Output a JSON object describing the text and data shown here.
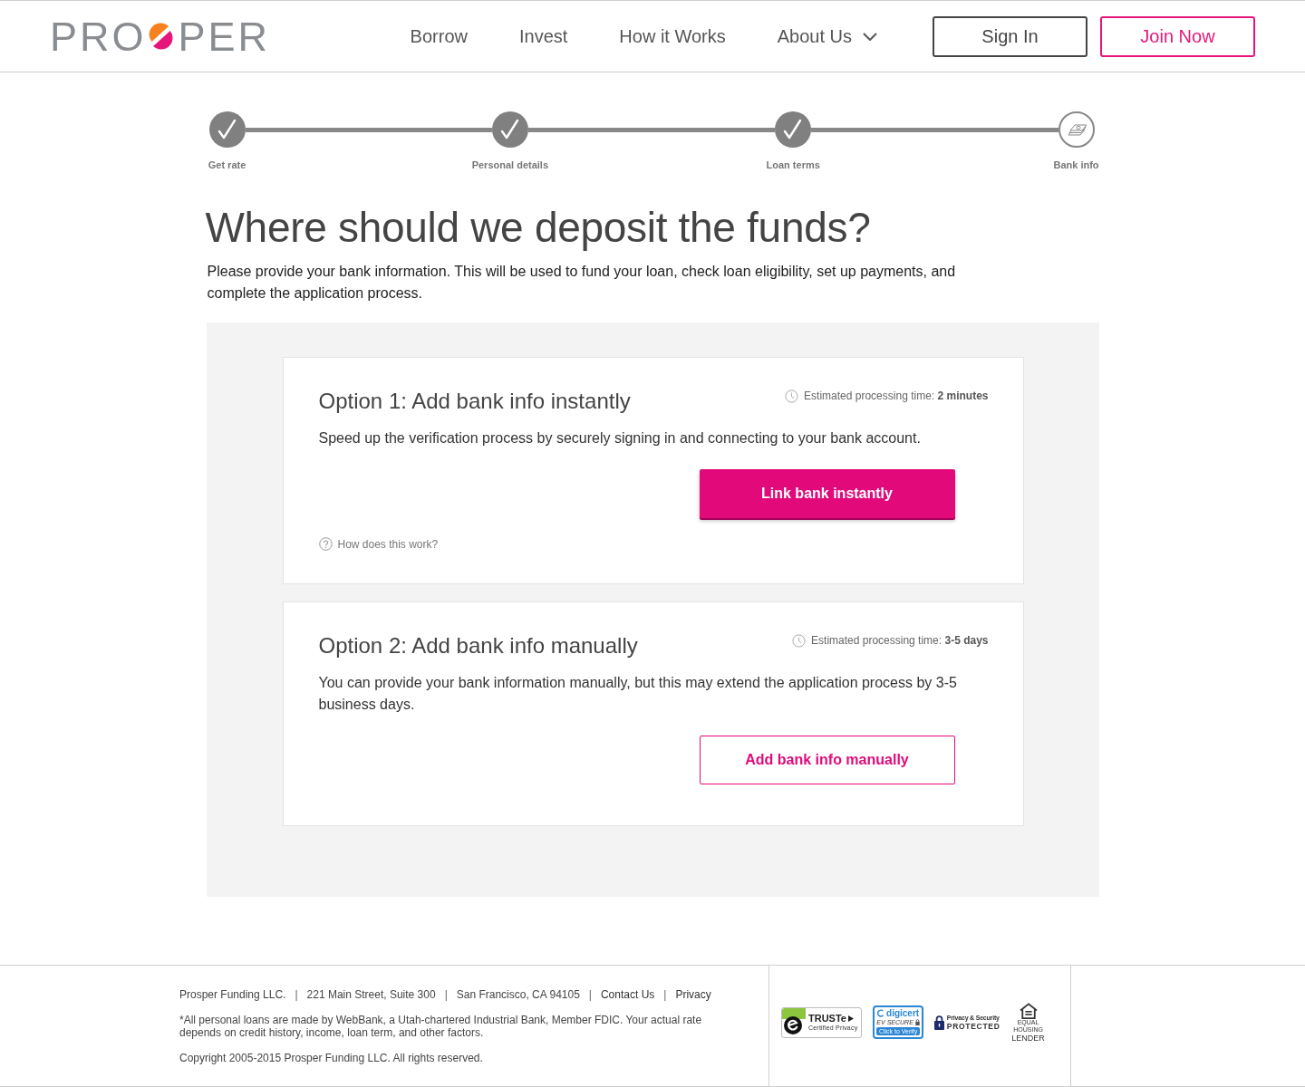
{
  "header": {
    "logo": {
      "left": "PRO",
      "right": "PER"
    },
    "nav": [
      {
        "label": "Borrow",
        "dropdown": false
      },
      {
        "label": "Invest",
        "dropdown": false
      },
      {
        "label": "How it Works",
        "dropdown": false
      },
      {
        "label": "About Us",
        "dropdown": true
      }
    ],
    "actions": [
      {
        "label": "Sign In",
        "kind": "secondary"
      },
      {
        "label": "Join Now",
        "kind": "primary"
      }
    ]
  },
  "steps": [
    {
      "label": "Get rate",
      "completed": true
    },
    {
      "label": "Personal details",
      "completed": true
    },
    {
      "label": "Loan terms",
      "completed": true
    },
    {
      "label": "Bank info",
      "completed": false
    }
  ],
  "heading": "Where should we deposit the funds?",
  "intro": "Please provide your bank information. This will be used to fund your loan, check loan eligibility, set up payments, and complete the application process.",
  "options": [
    {
      "title": "Option 1: Add bank info instantly",
      "estimate": "Estimated processing time: **2 minutes**",
      "description": "Speed up the verification process by securely signing in and connecting to your bank account.",
      "button": {
        "label": "Link bank instantly",
        "kind": "filled"
      },
      "help_link": "How does this work?"
    },
    {
      "title": "Option 2: Add bank info manually",
      "estimate": "Estimated processing time: **3-5 days**",
      "description": "You can provide your bank information manually, but this may extend the application process by 3-5 business days.",
      "button": {
        "label": "Add bank info manually",
        "kind": "outline"
      }
    }
  ],
  "footer": {
    "contact_line": [
      {
        "kind": "text",
        "text": "Prosper Funding LLC."
      },
      {
        "kind": "separator",
        "text": "|"
      },
      {
        "kind": "text",
        "text": "221 Main Street, Suite 300"
      },
      {
        "kind": "separator",
        "text": "|"
      },
      {
        "kind": "text",
        "text": "San Francisco, CA 94105"
      },
      {
        "kind": "separator",
        "text": "|"
      },
      {
        "kind": "link",
        "text": "Contact Us"
      },
      {
        "kind": "separator",
        "text": "|"
      },
      {
        "kind": "link",
        "text": "Privacy"
      }
    ],
    "disclaimer": "*All personal loans are made by WebBank, a Utah-chartered Industrial Bank, Member FDIC. Your actual rate depends on credit history, income, loan term, and other factors.",
    "copyright": "Copyright 2005-2015 Prosper Funding LLC. All rights reserved.",
    "badges": [
      {
        "kind": "truste",
        "lines": [
          "TRUSTe",
          "Certified Privacy"
        ]
      },
      {
        "kind": "digicert",
        "lines": [
          "digicert",
          "EV SECURE",
          "Click to Verify"
        ]
      },
      {
        "kind": "privacy",
        "lines": [
          "Privacy & Security",
          "PROTECTED"
        ]
      },
      {
        "kind": "housing",
        "lines": [
          "EQUAL HOUSING",
          "LENDER"
        ]
      }
    ]
  }
}
